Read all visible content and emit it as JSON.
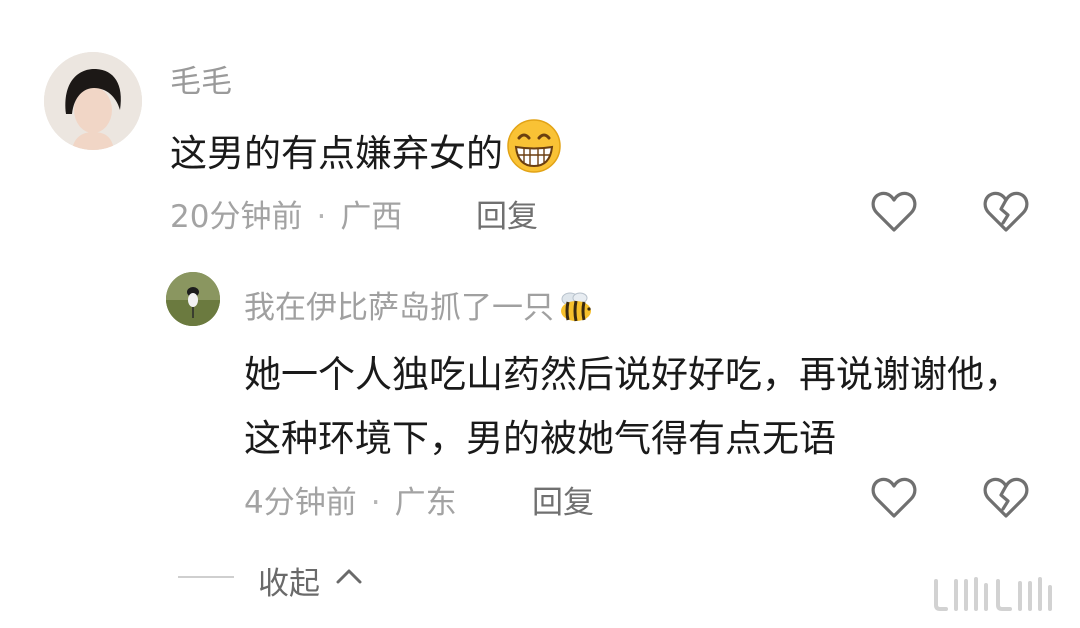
{
  "main_comment": {
    "username": "毛毛",
    "text": "这男的有点嫌弃女的",
    "emoji": "grinning-face-emoji",
    "time": "20分钟前",
    "separator": "·",
    "location": "广西",
    "reply_label": "回复"
  },
  "reply_comment": {
    "username": "我在伊比萨岛抓了一只",
    "emoji": "bee-emoji",
    "text": "她一个人独吃山药然后说好好吃，再说谢谢他，这种环境下，男的被她气得有点无语",
    "time": "4分钟前",
    "separator": "·",
    "location": "广东",
    "reply_label": "回复"
  },
  "collapse": {
    "label": "收起"
  },
  "icons": {
    "like": "heart-outline-icon",
    "dislike": "broken-heart-icon",
    "collapse": "chevron-up-icon"
  },
  "colors": {
    "text_primary": "#1a1a1a",
    "text_secondary": "#a3a3a3",
    "reply_link": "#707070"
  }
}
